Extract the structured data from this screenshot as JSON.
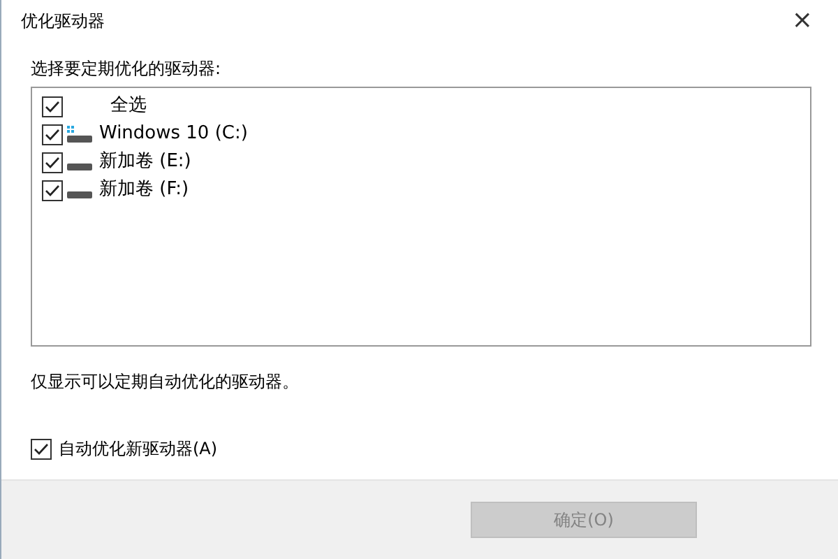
{
  "window": {
    "title": "优化驱动器",
    "close": "×"
  },
  "drives_label": "选择要定期优化的驱动器:",
  "drives": [
    {
      "kind": "select_all",
      "label": "全选",
      "checked": true
    },
    {
      "kind": "system_drive",
      "label": "Windows 10 (C:)",
      "checked": true
    },
    {
      "kind": "drive",
      "label": "新加卷 (E:)",
      "checked": true
    },
    {
      "kind": "drive",
      "label": "新加卷 (F:)",
      "checked": true
    }
  ],
  "hint": "仅显示可以定期自动优化的驱动器。",
  "auto_optimize": {
    "label": "自动优化新驱动器(A)",
    "checked": true
  },
  "buttons": [
    {
      "label": "确定(O)",
      "disabled": true
    }
  ]
}
